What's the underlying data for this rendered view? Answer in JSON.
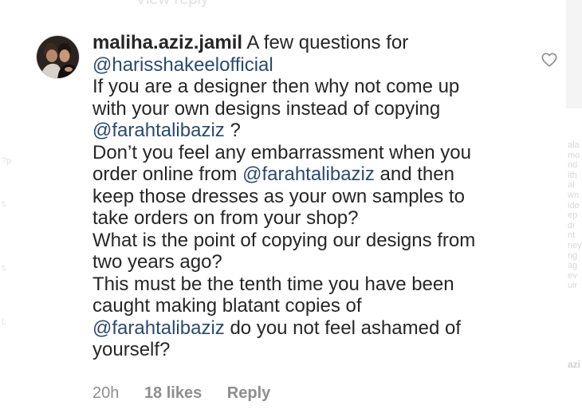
{
  "top_fragment": "View reply",
  "comment": {
    "username": "maliha.aziz.jamil",
    "lines": [
      [
        {
          "t": "A few questions for"
        }
      ],
      [
        {
          "t": "@harisshakeelofficial",
          "m": true
        }
      ],
      [
        {
          "t": "If you are a designer then why not come up"
        }
      ],
      [
        {
          "t": "with your own designs instead of copying"
        }
      ],
      [
        {
          "t": "@farahtalibaziz",
          "m": true
        },
        {
          "t": " ?"
        }
      ],
      [
        {
          "t": "Don’t you feel any embarrassment when you"
        }
      ],
      [
        {
          "t": "order online from "
        },
        {
          "t": "@farahtalibaziz",
          "m": true
        },
        {
          "t": " and then"
        }
      ],
      [
        {
          "t": "keep those dresses as your own samples to"
        }
      ],
      [
        {
          "t": "take orders on from your shop?"
        }
      ],
      [
        {
          "t": "What is the point of copying our designs from"
        }
      ],
      [
        {
          "t": "two years ago?"
        }
      ],
      [
        {
          "t": "This must be the tenth time you have been"
        }
      ],
      [
        {
          "t": "caught making blatant copies of"
        }
      ],
      [
        {
          "t": "@farahtalibaziz",
          "m": true
        },
        {
          "t": " do you not feel ashamed of"
        }
      ],
      [
        {
          "t": "yourself?"
        }
      ]
    ]
  },
  "footer": {
    "time": "20h",
    "likes": "18 likes",
    "reply": "Reply"
  },
  "colors": {
    "text": "#262626",
    "mention": "#2c4a6b",
    "meta": "#8e8e8e"
  },
  "icons": {
    "like": "heart-outline-icon"
  }
}
